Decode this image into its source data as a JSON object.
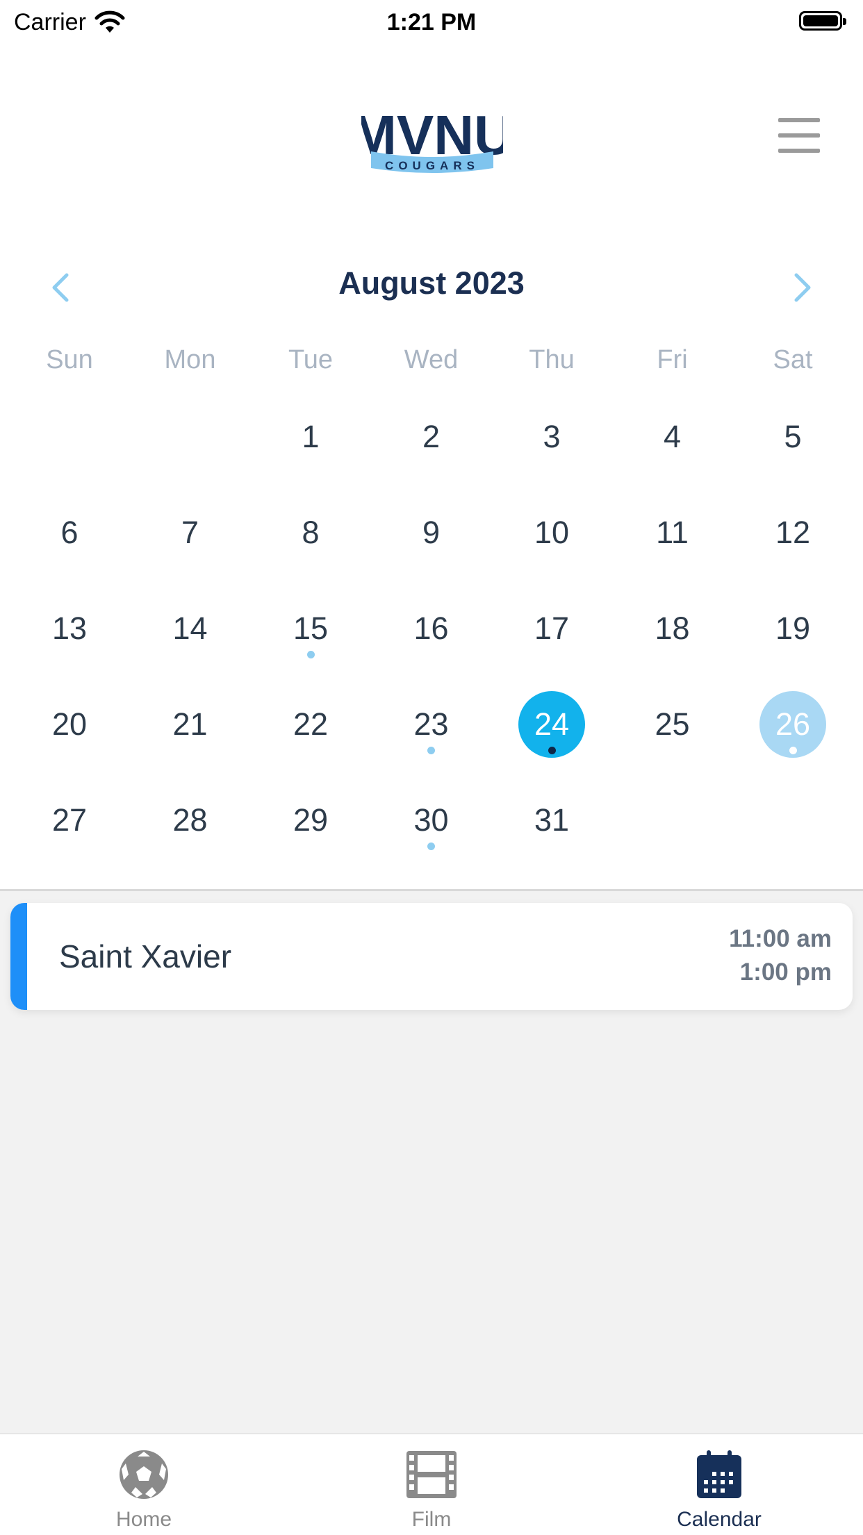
{
  "status_bar": {
    "carrier": "Carrier",
    "time": "1:21 PM"
  },
  "header": {
    "logo_text": "MVNU",
    "logo_subtext": "COUGARS"
  },
  "calendar": {
    "month_title": "August 2023",
    "weekdays": [
      "Sun",
      "Mon",
      "Tue",
      "Wed",
      "Thu",
      "Fri",
      "Sat"
    ],
    "first_weekday_index": 2,
    "days": [
      "1",
      "2",
      "3",
      "4",
      "5",
      "6",
      "7",
      "8",
      "9",
      "10",
      "11",
      "12",
      "13",
      "14",
      "15",
      "16",
      "17",
      "18",
      "19",
      "20",
      "21",
      "22",
      "23",
      "24",
      "25",
      "26",
      "27",
      "28",
      "29",
      "30",
      "31"
    ],
    "event_days": [
      15,
      23,
      24,
      26,
      30
    ],
    "today": 24,
    "selected": 26,
    "colors": {
      "today": "#12b2ec",
      "selected": "#a9d8f4",
      "event_dot": "#8ecdf0",
      "title": "#1b2f52"
    }
  },
  "events": [
    {
      "name": "Saint Xavier",
      "start": "11:00 am",
      "end": "1:00 pm",
      "accent": "#1e8ff8"
    }
  ],
  "tabs": [
    {
      "label": "Home",
      "icon": "soccer-ball-icon",
      "active": false
    },
    {
      "label": "Film",
      "icon": "film-icon",
      "active": false
    },
    {
      "label": "Calendar",
      "icon": "calendar-icon",
      "active": true
    }
  ]
}
